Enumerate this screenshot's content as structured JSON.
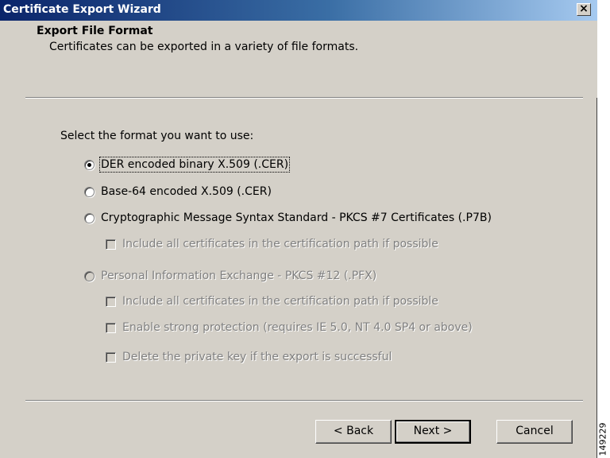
{
  "window": {
    "title": "Certificate Export Wizard",
    "close_label": "×"
  },
  "header": {
    "title": "Export File Format",
    "subtitle": "Certificates can be exported in a variety of file formats."
  },
  "prompt": "Select the format you want to use:",
  "options": {
    "der": {
      "label": "DER encoded binary X.509 (.CER)",
      "selected": true,
      "enabled": true
    },
    "base64": {
      "label": "Base-64 encoded X.509 (.CER)",
      "selected": false,
      "enabled": true
    },
    "pkcs7": {
      "label": "Cryptographic Message Syntax Standard - PKCS #7 Certificates (.P7B)",
      "selected": false,
      "enabled": true
    },
    "pkcs7_include": {
      "label": "Include all certificates in the certification path if possible",
      "checked": false,
      "enabled": false
    },
    "pfx": {
      "label": "Personal Information Exchange - PKCS #12 (.PFX)",
      "selected": false,
      "enabled": false
    },
    "pfx_include": {
      "label": "Include all certificates in the certification path if possible",
      "checked": false,
      "enabled": false
    },
    "pfx_strong": {
      "label": "Enable strong protection (requires IE 5.0, NT 4.0 SP4 or above)",
      "checked": false,
      "enabled": false
    },
    "pfx_delete": {
      "label": "Delete the private key if the export is successful",
      "checked": false,
      "enabled": false
    }
  },
  "buttons": {
    "back": "< Back",
    "next": "Next >",
    "cancel": "Cancel"
  },
  "figure_code": "149229",
  "colors": {
    "title_start": "#0a246a",
    "title_end": "#a6caf0",
    "face": "#d4d0c8",
    "disabled_text": "#808080"
  }
}
